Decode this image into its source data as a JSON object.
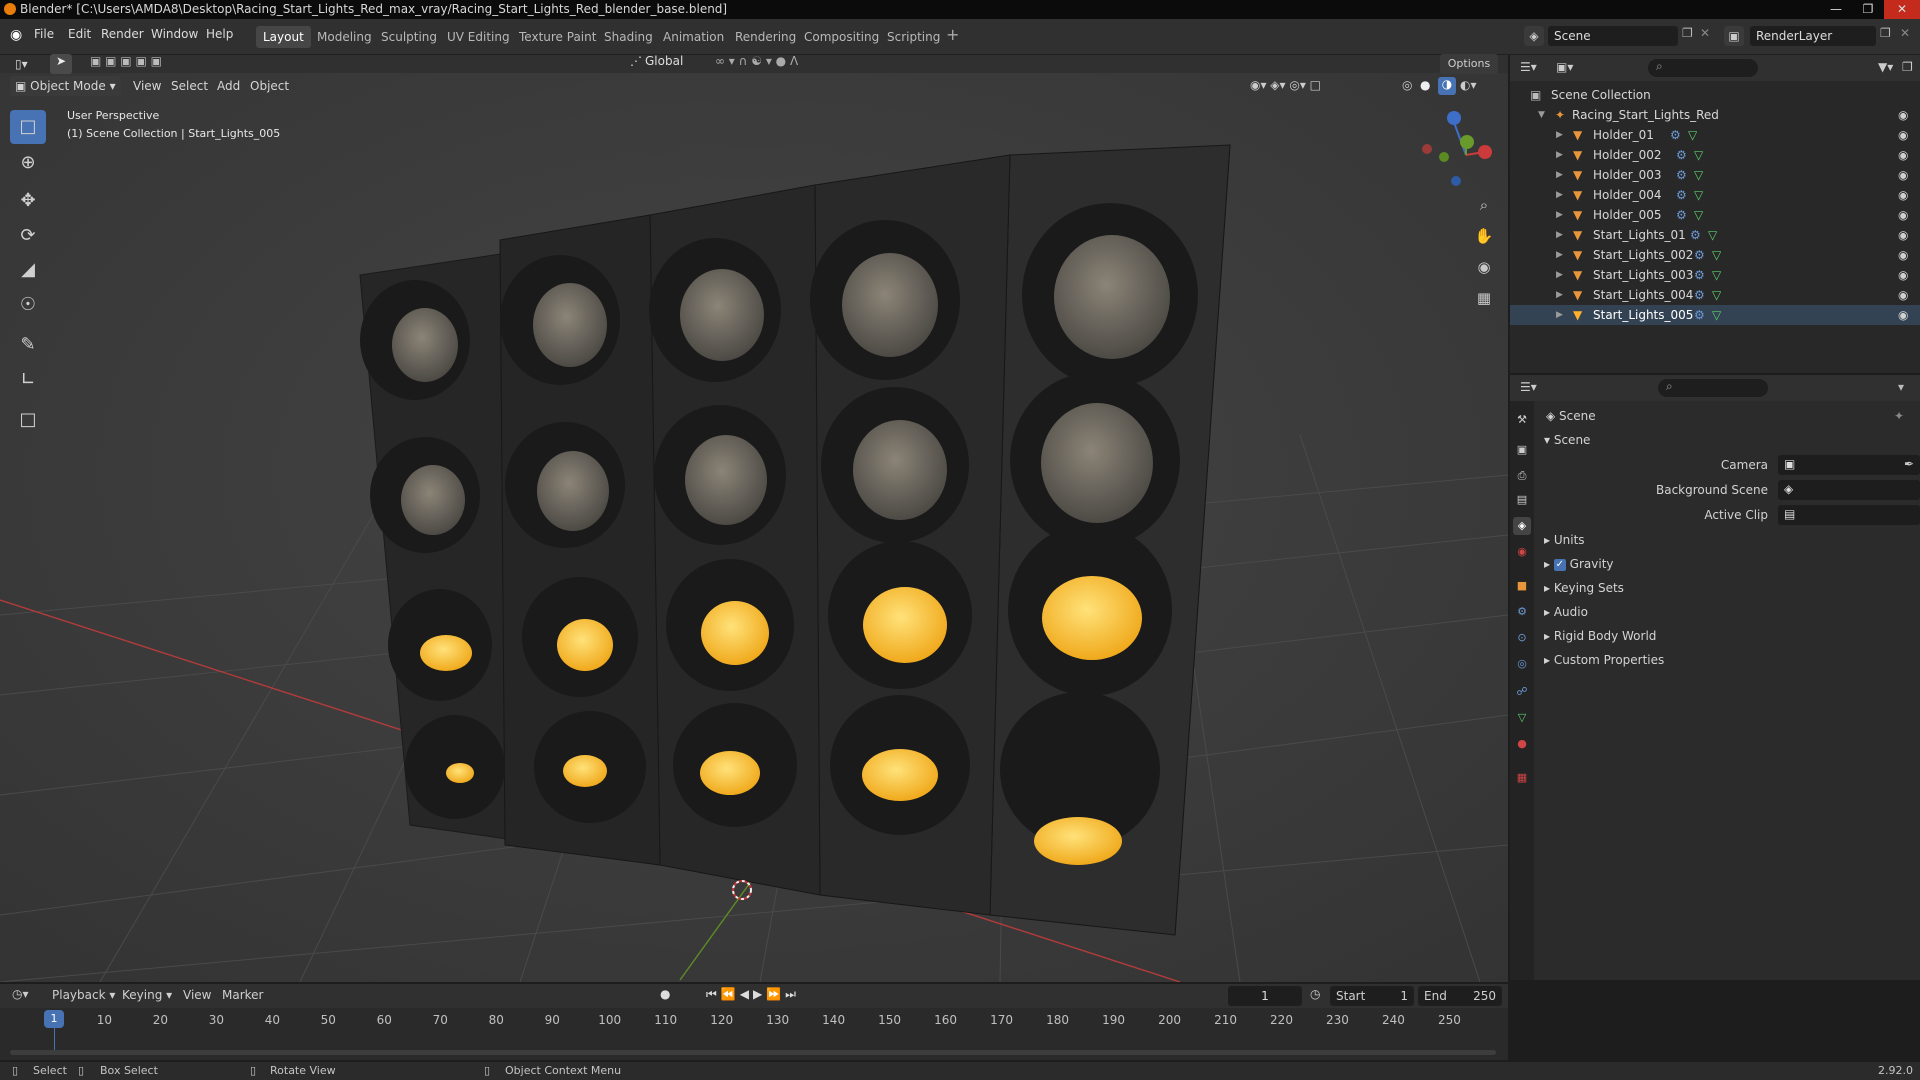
{
  "window": {
    "title": "Blender* [C:\\Users\\AMDA8\\Desktop\\Racing_Start_Lights_Red_max_vray/Racing_Start_Lights_Red_blender_base.blend]"
  },
  "menus": [
    "File",
    "Edit",
    "Render",
    "Window",
    "Help"
  ],
  "workspaces": [
    "Layout",
    "Modeling",
    "Sculpting",
    "UV Editing",
    "Texture Paint",
    "Shading",
    "Animation",
    "Rendering",
    "Compositing",
    "Scripting"
  ],
  "scene_name": "Scene",
  "render_layer": "RenderLayer",
  "toolbar": {
    "orientation": "Global",
    "options": "Options"
  },
  "viewport": {
    "mode": "Object Mode",
    "menus": [
      "View",
      "Select",
      "Add",
      "Object"
    ],
    "info_line1": "User Perspective",
    "info_line2": "(1) Scene Collection | Start_Lights_005"
  },
  "outliner": {
    "root": "Scene Collection",
    "collection": "Racing_Start_Lights_Red",
    "objects": [
      "Holder_01",
      "Holder_002",
      "Holder_003",
      "Holder_004",
      "Holder_005",
      "Start_Lights_01",
      "Start_Lights_002",
      "Start_Lights_003",
      "Start_Lights_004",
      "Start_Lights_005"
    ]
  },
  "properties": {
    "header": "Scene",
    "panel": "Scene",
    "camera_label": "Camera",
    "bg_scene_label": "Background Scene",
    "active_clip_label": "Active Clip",
    "sections": [
      "Units",
      "Gravity",
      "Keying Sets",
      "Audio",
      "Rigid Body World",
      "Custom Properties"
    ],
    "gravity_checked": true
  },
  "timeline": {
    "menus": [
      "Playback",
      "Keying",
      "View",
      "Marker"
    ],
    "current_frame": "1",
    "start_label": "Start",
    "start": "1",
    "end_label": "End",
    "end": "250",
    "ticks": [
      "1",
      "10",
      "20",
      "30",
      "40",
      "50",
      "60",
      "70",
      "80",
      "90",
      "100",
      "110",
      "120",
      "130",
      "140",
      "150",
      "160",
      "170",
      "180",
      "190",
      "200",
      "210",
      "220",
      "230",
      "240",
      "250"
    ]
  },
  "statusbar": {
    "select": "Select",
    "box_select": "Box Select",
    "rotate_view": "Rotate View",
    "context_menu": "Object Context Menu",
    "version": "2.92.0"
  },
  "colors": {
    "accent": "#4772b3",
    "light_on": "#ffc23a",
    "x_axis": "#c43c3c",
    "y_axis": "#6a9a2a"
  }
}
